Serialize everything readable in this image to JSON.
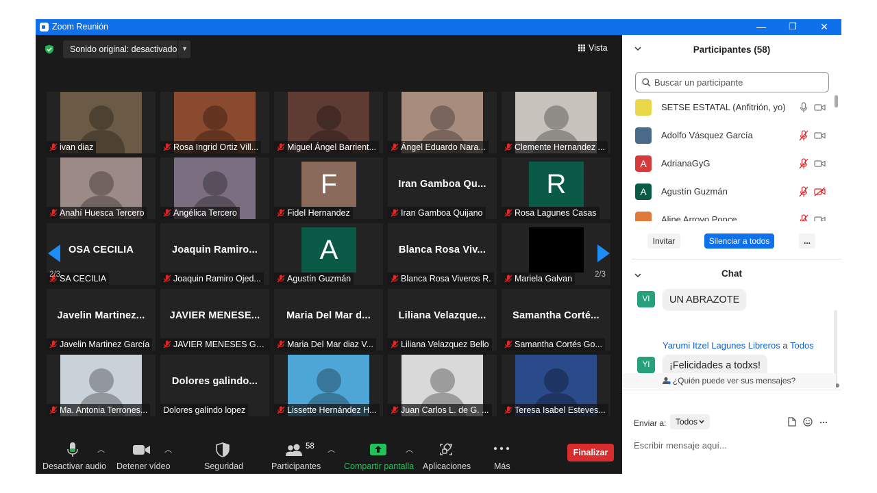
{
  "window": {
    "title": "Zoom Reunión",
    "minimize": "—",
    "restore": "❐",
    "close": "✕"
  },
  "meeting": {
    "sound_label": "Sonido original: desactivado",
    "view_label": "Vista",
    "page_indicator": "2/3",
    "tiles": [
      {
        "name": "ivan diaz",
        "kind": "video",
        "color": "#6b5a45"
      },
      {
        "name": "Rosa Ingrid Ortiz Vill...",
        "kind": "video",
        "color": "#8a4a2f"
      },
      {
        "name": "Miguel Ángel Barrient...",
        "kind": "video",
        "color": "#5e3b33"
      },
      {
        "name": "Ángel Eduardo Nara...",
        "kind": "video",
        "color": "#a88d7e"
      },
      {
        "name": "Clemente Hernandez ...",
        "kind": "video",
        "color": "#c8c2bd"
      },
      {
        "name": "Anahí Huesca Tercero",
        "kind": "video",
        "color": "#9b8a86"
      },
      {
        "name": "Angélica Tercero",
        "kind": "video",
        "color": "#7a6e80"
      },
      {
        "name": "Fidel Hernandez",
        "kind": "avatar",
        "letter": "F",
        "color": "#8a6a5a"
      },
      {
        "name": "Iran Gamboa Quijano",
        "kind": "text",
        "big": "Iran Gamboa Qu..."
      },
      {
        "name": "Rosa Lagunes Casas",
        "kind": "avatar",
        "letter": "R",
        "color": "#0b5a47"
      },
      {
        "name": "SA CECILIA",
        "kind": "text",
        "big": "OSA CECILIA"
      },
      {
        "name": "Joaquin Ramiro Ojed...",
        "kind": "text",
        "big": "Joaquin  Ramiro..."
      },
      {
        "name": "Agustín Guzmán",
        "kind": "avatar",
        "letter": "A",
        "color": "#0b5a47"
      },
      {
        "name": "Blanca Rosa Viveros R.",
        "kind": "text",
        "big": "Blanca Rosa Viv..."
      },
      {
        "name": "Mariela Galvan",
        "kind": "black"
      },
      {
        "name": "Javelin Martinez García",
        "kind": "text",
        "big": "Javelin  Martinez..."
      },
      {
        "name": "JAVIER MENESES GA...",
        "kind": "text",
        "big": "JAVIER  MENESE..."
      },
      {
        "name": "Maria Del Mar diaz V...",
        "kind": "text",
        "big": "Maria Del Mar d..."
      },
      {
        "name": "Liliana Velazquez Bello",
        "kind": "text",
        "big": "Liliana  Velazque..."
      },
      {
        "name": "Samantha Cortés Go...",
        "kind": "text",
        "big": "Samantha  Corté..."
      },
      {
        "name": "Ma. Antonia Terrones...",
        "kind": "video",
        "color": "#c9d2d8"
      },
      {
        "name": "Dolores galindo lopez",
        "kind": "text",
        "big": "Dolores  galindo...",
        "nomic": true
      },
      {
        "name": "Lissette Hernández H...",
        "kind": "video",
        "color": "#4ea6d6"
      },
      {
        "name": "Juan Carlos L. de G. ...",
        "kind": "video",
        "color": "#d9d9d9"
      },
      {
        "name": "Teresa Isabel Esteves...",
        "kind": "video",
        "color": "#2a4a8a"
      }
    ]
  },
  "toolbar": {
    "audio": "Desactivar audio",
    "video": "Detener vídeo",
    "security": "Seguridad",
    "participants": "Participantes",
    "participants_count": "58",
    "share": "Compartir pantalla",
    "apps": "Aplicaciones",
    "more": "Más",
    "end": "Finalizar"
  },
  "panel": {
    "participants_title": "Participantes (58)",
    "search_placeholder": "Buscar un participante",
    "participants": [
      {
        "name": "SETSE ESTATAL (Anfitrión, yo)",
        "avatar": "",
        "color": "#e8d84a",
        "mic_muted": false,
        "cam_off": false
      },
      {
        "name": "Adolfo Vásquez García",
        "avatar": "",
        "color": "#4a6a8a",
        "mic_muted": true,
        "cam_off": false
      },
      {
        "name": "AdrianaGyG",
        "avatar": "A",
        "color": "#d63b3b",
        "mic_muted": true,
        "cam_off": false
      },
      {
        "name": "Agustín Guzmán",
        "avatar": "A",
        "color": "#0b5a47",
        "mic_muted": true,
        "cam_off": true
      },
      {
        "name": "Aline Arroyo Ponce",
        "avatar": "",
        "color": "#e07a3a",
        "mic_muted": true,
        "cam_off": false
      }
    ],
    "invite": "Invitar",
    "mute_all": "Silenciar a todos",
    "more": "...",
    "chat_title": "Chat",
    "messages": [
      {
        "initials": "VI",
        "text": "UN ABRAZOTE"
      },
      {
        "sender": "Yarumi Itzel Lagunes Libreros",
        "to_word": "a",
        "to": "Todos",
        "initials": "YI",
        "text": "¡Felicidades a todxs!"
      }
    ],
    "who_can_see": "¿Quién puede ver sus mensajes?",
    "send_to_label": "Enviar a:",
    "send_to_value": "Todos",
    "input_placeholder": "Escribir mensaje aquí..."
  }
}
